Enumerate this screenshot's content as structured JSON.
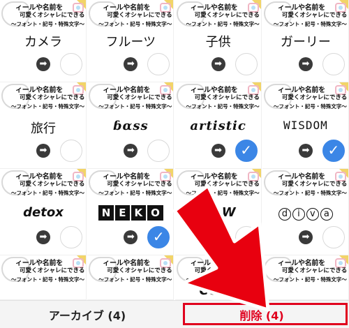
{
  "thumbnail_text": {
    "line1": "ィールや名前を",
    "line2": "可愛くオシャレにできる",
    "line3": "〜フォント・記号・特殊文字〜"
  },
  "cards": [
    {
      "name": "card-kamera",
      "word": "カメラ",
      "style": "w-serif",
      "checked": false
    },
    {
      "name": "card-furutsu",
      "word": "フルーツ",
      "style": "w-serif",
      "checked": false
    },
    {
      "name": "card-kodomo",
      "word": "子供",
      "style": "w-serif",
      "checked": false
    },
    {
      "name": "card-garii",
      "word": "ガーリー",
      "style": "w-serif",
      "checked": false
    },
    {
      "name": "card-ryokou",
      "word": "旅行",
      "style": "w-serif",
      "checked": false
    },
    {
      "name": "card-bass",
      "word": "ɓαss",
      "style": "w-italic-bold",
      "checked": false
    },
    {
      "name": "card-artistic",
      "word": "artistic",
      "style": "w-italic-bold",
      "checked": true
    },
    {
      "name": "card-wisdom",
      "word": "WISDOM",
      "style": "w-mono",
      "checked": true
    },
    {
      "name": "card-detox",
      "word": "detox",
      "style": "w-bold-italic",
      "checked": false
    },
    {
      "name": "card-neko",
      "word": "NEKO",
      "style": "w-boxed",
      "checked": true
    },
    {
      "name": "card-dow",
      "word": "DOW",
      "style": "w-bold-italic",
      "checked": false
    },
    {
      "name": "card-diva",
      "word": "diva",
      "style": "w-circled",
      "checked": false
    },
    {
      "name": "card-r4-1",
      "word": "",
      "style": "w-serif",
      "checked": false
    },
    {
      "name": "card-r4-2",
      "word": "",
      "style": "w-serif",
      "checked": false
    },
    {
      "name": "card-r4-3",
      "word": "COVE",
      "style": "w-bold-italic",
      "checked": false
    },
    {
      "name": "card-r4-4",
      "word": "",
      "style": "w-serif",
      "checked": false
    }
  ],
  "icons": {
    "open": "arrow-right-circle-icon",
    "check": "check-icon"
  },
  "glyphs": {
    "arrow": "➡",
    "check": "✓"
  },
  "bottom_bar": {
    "archive_label": "アーカイブ (4)",
    "delete_label": "削除 (4)"
  },
  "colors": {
    "accent_blue": "#3b86e6",
    "delete_red": "#e0001d",
    "callout_arrow": "#e8000f"
  }
}
